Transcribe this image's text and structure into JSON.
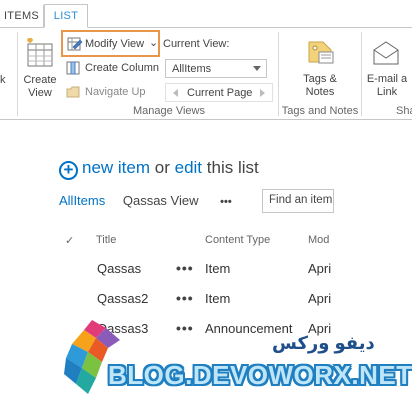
{
  "tabs": {
    "items": "ITEMS",
    "list": "LIST"
  },
  "ribbon": {
    "create_view": "Create View",
    "modify_view": "Modify View",
    "modify_view_arrow": "⌄",
    "create_column": "Create Column",
    "navigate_up": "Navigate Up",
    "current_view_label": "Current View:",
    "current_view_value": "AllItems",
    "current_page": "Current Page",
    "manage_views": "Manage Views",
    "tags_notes": "Tags & Notes",
    "tags_notes_group": "Tags and Notes",
    "email_link": "E-mail a Link",
    "sha_group": "Sha",
    "cut_left": "k"
  },
  "content": {
    "new_item": "new item",
    "or": "or",
    "edit": "edit",
    "this_list": "this list",
    "view_all_items": "AllItems",
    "view_qassas": "Qassas View",
    "more": "•••",
    "search_placeholder": "Find an item"
  },
  "table": {
    "headers": {
      "check": "✓",
      "title": "Title",
      "content_type": "Content Type",
      "modified": "Mod"
    },
    "rows": [
      {
        "title": "Qassas",
        "content_type": "Item",
        "modified": "Apri"
      },
      {
        "title": "Qassas2",
        "content_type": "Item",
        "modified": "Apri"
      },
      {
        "title": "Qassas3",
        "content_type": "Announcement",
        "modified": "Apri"
      }
    ],
    "row_dots": "•••"
  },
  "watermark": {
    "arabic": "ديفو وركس",
    "url": "BLOG.DEVOWORX.NET"
  },
  "colors": {
    "accent": "#0072c6",
    "highlight": "#e8964a",
    "tab_active": "#2a8dd4"
  }
}
